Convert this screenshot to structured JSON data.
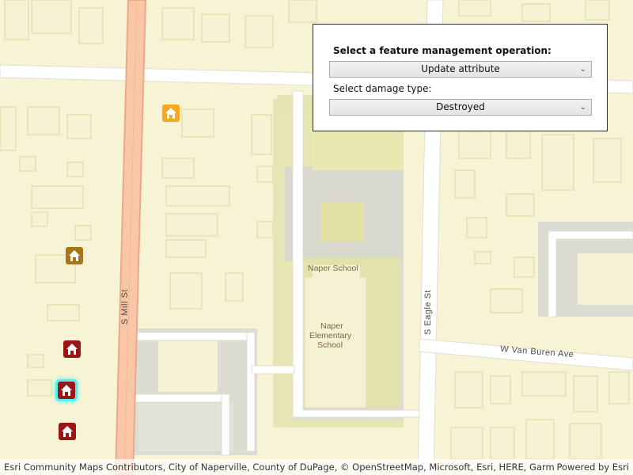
{
  "panel": {
    "title": "Select a feature management operation:",
    "operation_value": "Update attribute",
    "damage_label": "Select damage type:",
    "damage_value": "Destroyed"
  },
  "map": {
    "streets": [
      "S Mill St",
      "S Eagle St",
      "W Van Buren Ave"
    ],
    "poi": {
      "school_name": "Naper School",
      "school_name_2_line1": "Naper",
      "school_name_2_line2": "Elementary",
      "school_name_2_line3": "School"
    },
    "markers": [
      {
        "name": "house-marker-1",
        "color": "#f5a91e"
      },
      {
        "name": "house-marker-2",
        "color": "#a8741a"
      },
      {
        "name": "house-marker-3",
        "color": "#9c1516"
      },
      {
        "name": "house-marker-4-selected",
        "color": "#9c1516",
        "selected": true
      },
      {
        "name": "house-marker-5",
        "color": "#9c1516"
      }
    ]
  },
  "attribution": {
    "text": "Esri Community Maps Contributors, City of Naperville, County of DuPage, © OpenStreetMap, Microsoft, Esri, HERE, Garmin, SafeGr...",
    "powered_by": "Powered by Esri"
  }
}
